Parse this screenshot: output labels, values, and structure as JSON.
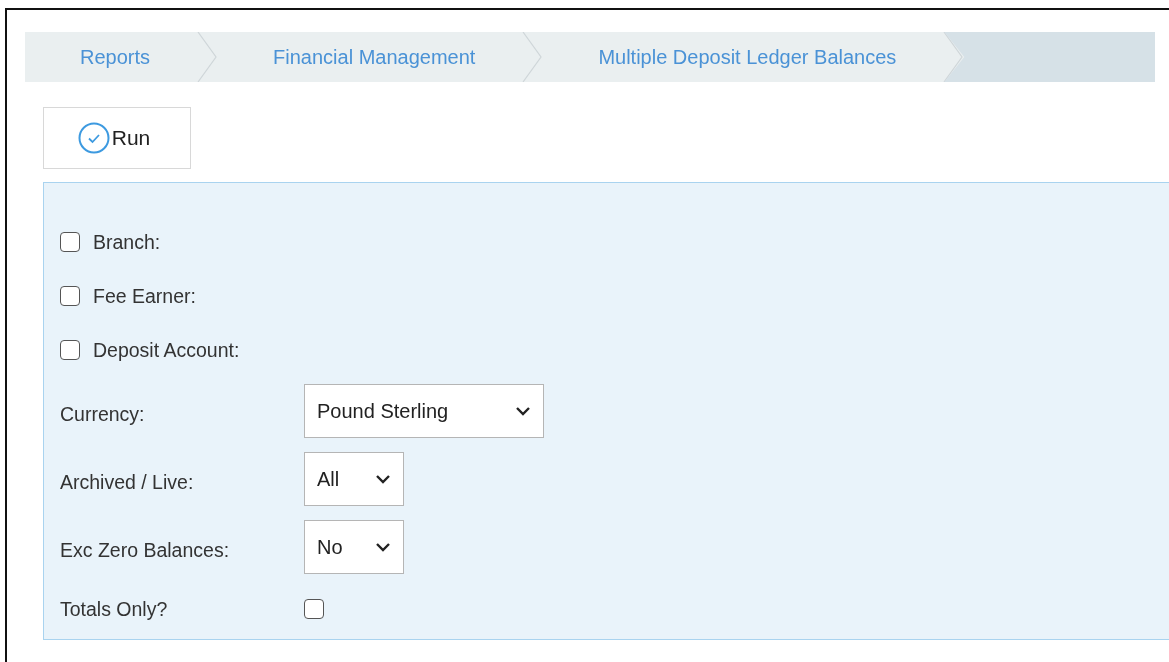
{
  "breadcrumb": [
    {
      "label": "Reports"
    },
    {
      "label": "Financial Management"
    },
    {
      "label": "Multiple Deposit Ledger Balances"
    }
  ],
  "run_button": {
    "label": "Run"
  },
  "fields": [
    {
      "kind": "checkbox",
      "label": "Branch:",
      "checked": false
    },
    {
      "kind": "checkbox",
      "label": "Fee Earner:",
      "checked": false
    },
    {
      "kind": "checkbox",
      "label": "Deposit Account:",
      "checked": false
    },
    {
      "kind": "select",
      "label": "Currency:",
      "value": "Pound Sterling"
    },
    {
      "kind": "select",
      "label": "Archived / Live:",
      "value": "All"
    },
    {
      "kind": "select",
      "label": "Exc Zero Balances:",
      "value": "No"
    },
    {
      "kind": "toggle",
      "label": "Totals Only?",
      "checked": false
    }
  ]
}
